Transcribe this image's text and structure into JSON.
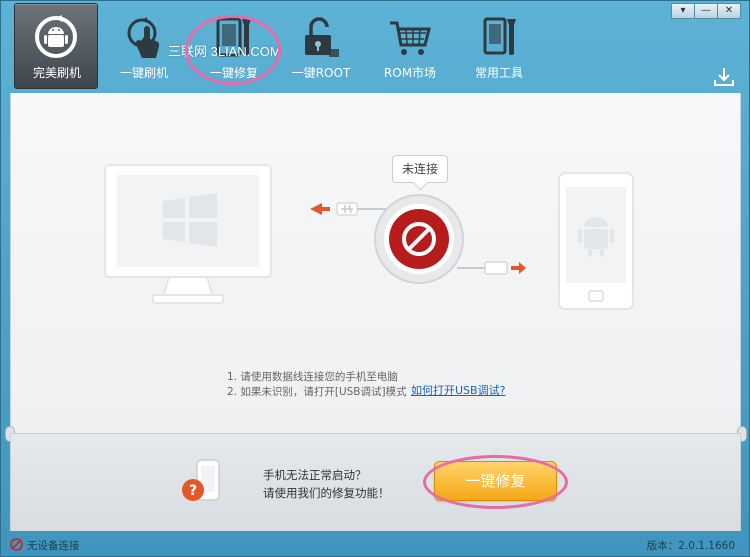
{
  "colors": {
    "accent_orange": "#f6a716",
    "annotation_pink": "#e86aa6",
    "link_blue": "#1b63b3",
    "disconnect_red": "#b71c1c"
  },
  "window_controls": {
    "menu": "▾",
    "minimize": "—",
    "close": "✕"
  },
  "nav": {
    "items": [
      {
        "label": "完美刷机",
        "icon": "android-refresh-icon",
        "active": true
      },
      {
        "label": "一键刷机",
        "icon": "touch-flash-icon",
        "active": false
      },
      {
        "label": "一键修复",
        "icon": "phone-repair-icon",
        "active": false
      },
      {
        "label": "一键ROOT",
        "icon": "unlock-icon",
        "active": false
      },
      {
        "label": "ROM市场",
        "icon": "shopping-cart-icon",
        "active": false
      },
      {
        "label": "常用工具",
        "icon": "tools-icon",
        "active": false
      }
    ],
    "watermark": "三联网 3LIAN.COM"
  },
  "main": {
    "status_bubble": "未连接",
    "instructions": [
      "1. 请使用数据线连接您的手机至电脑",
      "2. 如果未识别，请打开[USB调试]模式"
    ],
    "usb_link": "如何打开USB调试?"
  },
  "bottom": {
    "help_line1": "手机无法正常启动？",
    "help_line2": "请使用我们的修复功能！",
    "repair_button": "一键修复"
  },
  "statusbar": {
    "connection": "无设备连接",
    "version": "版本：2.0.1.1660"
  }
}
